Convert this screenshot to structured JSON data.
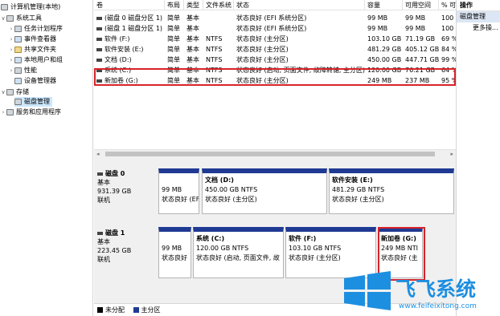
{
  "tree": [
    {
      "label": "计算机管理(本地)",
      "toggle": "",
      "icon": "g"
    },
    {
      "label": "系统工具",
      "toggle": "∨",
      "icon": "g"
    },
    {
      "label": "任务计划程序",
      "toggle": "›",
      "icon": "g"
    },
    {
      "label": "事件查看器",
      "toggle": "›",
      "icon": "b"
    },
    {
      "label": "共享文件夹",
      "toggle": "›",
      "icon": "y"
    },
    {
      "label": "本地用户和组",
      "toggle": "›",
      "icon": "b"
    },
    {
      "label": "性能",
      "toggle": "›",
      "icon": "g"
    },
    {
      "label": "设备管理器",
      "toggle": "",
      "icon": "b"
    },
    {
      "label": "存储",
      "toggle": "∨",
      "icon": "g"
    },
    {
      "label": "磁盘管理",
      "toggle": "",
      "icon": "g"
    },
    {
      "label": "服务和应用程序",
      "toggle": "›",
      "icon": "g"
    }
  ],
  "columns": [
    "卷",
    "布局",
    "类型",
    "文件系统",
    "状态",
    "容量",
    "可用空间",
    "% 可"
  ],
  "volumes": [
    [
      "(磁盘 0 磁盘分区 1)",
      "简单",
      "基本",
      "",
      "状态良好 (EFI 系统分区)",
      "99 MB",
      "99 MB",
      "100"
    ],
    [
      "(磁盘 1 磁盘分区 1)",
      "简单",
      "基本",
      "",
      "状态良好 (EFI 系统分区)",
      "99 MB",
      "99 MB",
      "100"
    ],
    [
      "软件 (F:)",
      "简单",
      "基本",
      "NTFS",
      "状态良好 (主分区)",
      "103.10 GB",
      "71.19 GB",
      "69 %"
    ],
    [
      "软件安装 (E:)",
      "简单",
      "基本",
      "NTFS",
      "状态良好 (主分区)",
      "481.29 GB",
      "405.12 GB",
      "84 %"
    ],
    [
      "文档 (D:)",
      "简单",
      "基本",
      "NTFS",
      "状态良好 (主分区)",
      "450.00 GB",
      "447.71 GB",
      "99 %"
    ],
    [
      "系统 (C:)",
      "简单",
      "基本",
      "NTFS",
      "状态良好 (启动, 页面文件, 故障转储, 主分区)",
      "120.00 GB",
      "76.21 GB",
      "64 %"
    ],
    [
      "新加卷 (G:)",
      "简单",
      "基本",
      "NTFS",
      "状态良好 (主分区)",
      "249 MB",
      "237 MB",
      "95 %"
    ]
  ],
  "disks": [
    {
      "name": "磁盘 0",
      "type": "基本",
      "size": "931.39 GB",
      "status": "联机",
      "partitions": [
        {
          "name": "",
          "size": "99 MB",
          "status": "状态良好 (EF"
        },
        {
          "name": "文档  (D:)",
          "size": "450.00 GB NTFS",
          "status": "状态良好 (主分区)"
        },
        {
          "name": "软件安装  (E:)",
          "size": "481.29 GB NTFS",
          "status": "状态良好 (主分区)"
        }
      ]
    },
    {
      "name": "磁盘 1",
      "type": "基本",
      "size": "223.45 GB",
      "status": "联机",
      "partitions": [
        {
          "name": "",
          "size": "99 MB",
          "status": "状态良好"
        },
        {
          "name": "系统  (C:)",
          "size": "120.00 GB NTFS",
          "status": "状态良好 (启动, 页面文件, 故"
        },
        {
          "name": "软件  (F:)",
          "size": "103.10 GB NTFS",
          "status": "状态良好 (主分区)"
        },
        {
          "name": "新加卷  (G:)",
          "size": "249 MB NTI",
          "status": "状态良好 (主"
        }
      ]
    }
  ],
  "legend": {
    "unallocated": "未分配",
    "primary": "主分区"
  },
  "actions": {
    "header": "操作",
    "section": "磁盘管理",
    "more": "更多操..."
  },
  "watermark": {
    "title": "飞飞系统",
    "url": "www.feifeixitong.com"
  },
  "colors": {
    "partition_bar": "#1f3a93",
    "highlight": "#d8232a",
    "unallocated": "#000000"
  }
}
